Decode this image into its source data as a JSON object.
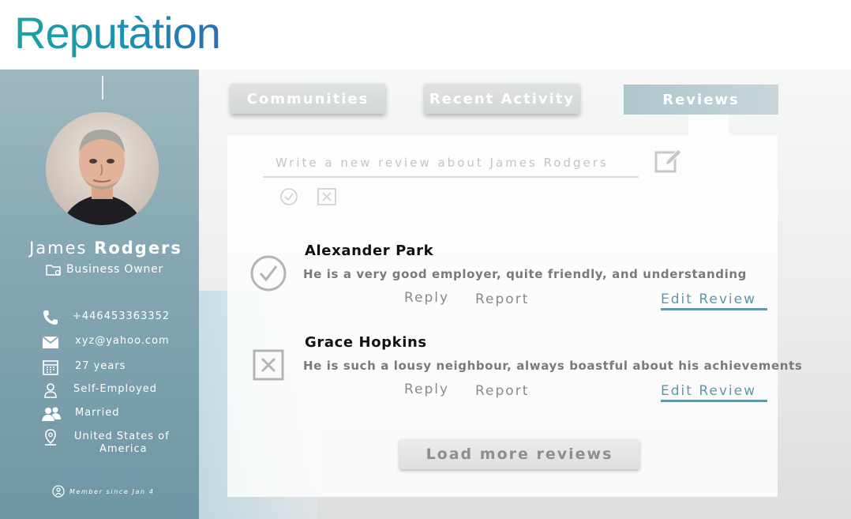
{
  "header": {
    "logo_text": "Reputàtion"
  },
  "profile": {
    "first_name": "James",
    "last_name": "Rodgers",
    "role": "Business Owner",
    "details": {
      "phone": "+446453363352",
      "email": "xyz@yahoo.com",
      "age": "27 years",
      "employment": "Self-Employed",
      "marital_status": "Married",
      "country_line1": "United States of",
      "country_line2": "America"
    },
    "member_since": "Member since Jan 4"
  },
  "tabs": {
    "communities": "Communities",
    "recent_activity": "Recent Activity",
    "reviews": "Reviews"
  },
  "composer": {
    "placeholder": "Write a new review about James Rodgers"
  },
  "reviews": [
    {
      "author": "Alexander Park",
      "text": "He is a very good employer, quite friendly, and understanding",
      "status": "approved"
    },
    {
      "author": "Grace Hopkins",
      "text": "He is such a lousy neighbour, always boastful about his achievements",
      "status": "rejected"
    }
  ],
  "review_actions": {
    "reply": "Reply",
    "report": "Report",
    "edit": "Edit Review"
  },
  "load_more_label": "Load more reviews",
  "colors": {
    "brand_teal": "#17a59d",
    "sidebar": "#86a8b3",
    "edit_link": "#5f97a8"
  }
}
